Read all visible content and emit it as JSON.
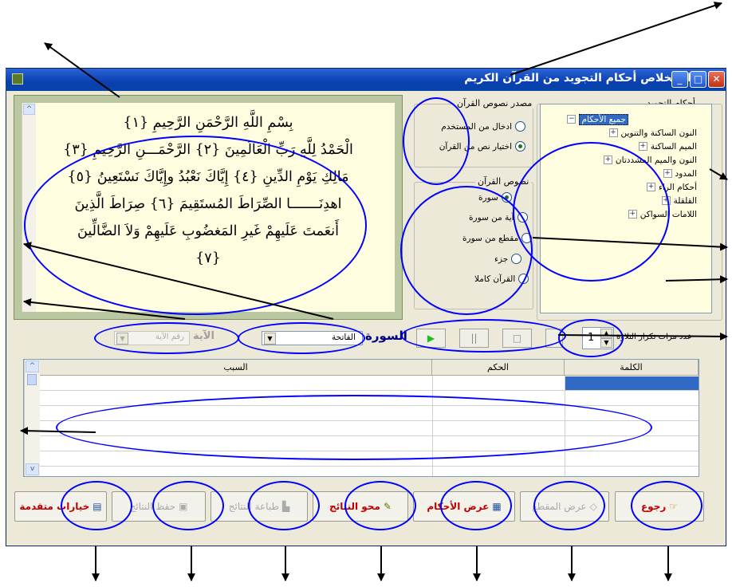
{
  "window": {
    "title": "استخلاص أحكام التجويد من القرآن الكريم"
  },
  "quran_text": {
    "lines": [
      "بِسْمِ اللَّهِ الرَّحْمَنِ الرَّحِيمِ {١}",
      "الْحَمْدُ لِلَّهِ رَبِّ الْعَالَمِينَ {٢} الرَّحْمَـــنِ الرَّحِيمِ {٣}",
      "مَالِكِ يَوْمِ الدِّينِ {٤} إِيَّاكَ نَعْبُدُ وإِيَّاكَ نَسْتَعِينُ {٥}",
      "اهدِنَـــــــا الصِّرَاطَ المُستَقِيمَ {٦} صِرَاطَ الَّذِينَ",
      "أَنعَمتَ عَلَيهِمْ غَيرِ المَغضُوبِ عَلَيهِمْ وَلاَ الضَّالِّينَ",
      "{٧}"
    ]
  },
  "source_group": {
    "label": "مصدر نصوص القرآن",
    "options": [
      "ادخال من المستخدم",
      "اختيار نص من القرآن"
    ],
    "selected_index": 1
  },
  "texts_group": {
    "label": "نصوص القرآن",
    "options": [
      "سورة",
      "آية من سورة",
      "مقطع من سورة",
      "جزء",
      "القرآن كاملا"
    ],
    "selected_index": 0
  },
  "rules_group": {
    "label": "أحكام التجويد",
    "root": "جميع الأحكام",
    "items": [
      "النون الساكنة والتنوين",
      "الميم الساكنة",
      "النون والميم المشددتان",
      "المدود",
      "أحكام الراء",
      "القلقلة",
      "اللامات السواكن"
    ]
  },
  "controls": {
    "surah_label": "السورة",
    "surah_value": "الفاتحة",
    "ayah_label": "الآية",
    "ayah_placeholder": "رقم الآية",
    "repeat_label": "عدد مرات تكرار التلاوة",
    "repeat_value": "1",
    "play_icon": "▶",
    "pause_icon": "||",
    "stop_icon": "□"
  },
  "table": {
    "headers": [
      "الكلمة",
      "الحكم",
      "السبب"
    ],
    "row_count": 7
  },
  "buttons": [
    {
      "label": "رجوع",
      "icon": "☞",
      "style": "red"
    },
    {
      "label": "عرض المقطع",
      "icon": "◇",
      "style": "disabled"
    },
    {
      "label": "عرض الأحكام",
      "icon": "▦",
      "style": "red"
    },
    {
      "label": "محو النتائج",
      "icon": "✎",
      "style": "red"
    },
    {
      "label": "طباعة النتائج",
      "icon": "▙",
      "style": "disabled"
    },
    {
      "label": "حفظ النتائج",
      "icon": "▣",
      "style": "disabled"
    },
    {
      "label": "خيارات متقدمة",
      "icon": "▤",
      "style": "red"
    }
  ],
  "colors": {
    "annotation_blue": "#0000ff",
    "selection_blue": "#316ac5",
    "active_red": "#c00000",
    "quran_bg": "#fffde0"
  }
}
